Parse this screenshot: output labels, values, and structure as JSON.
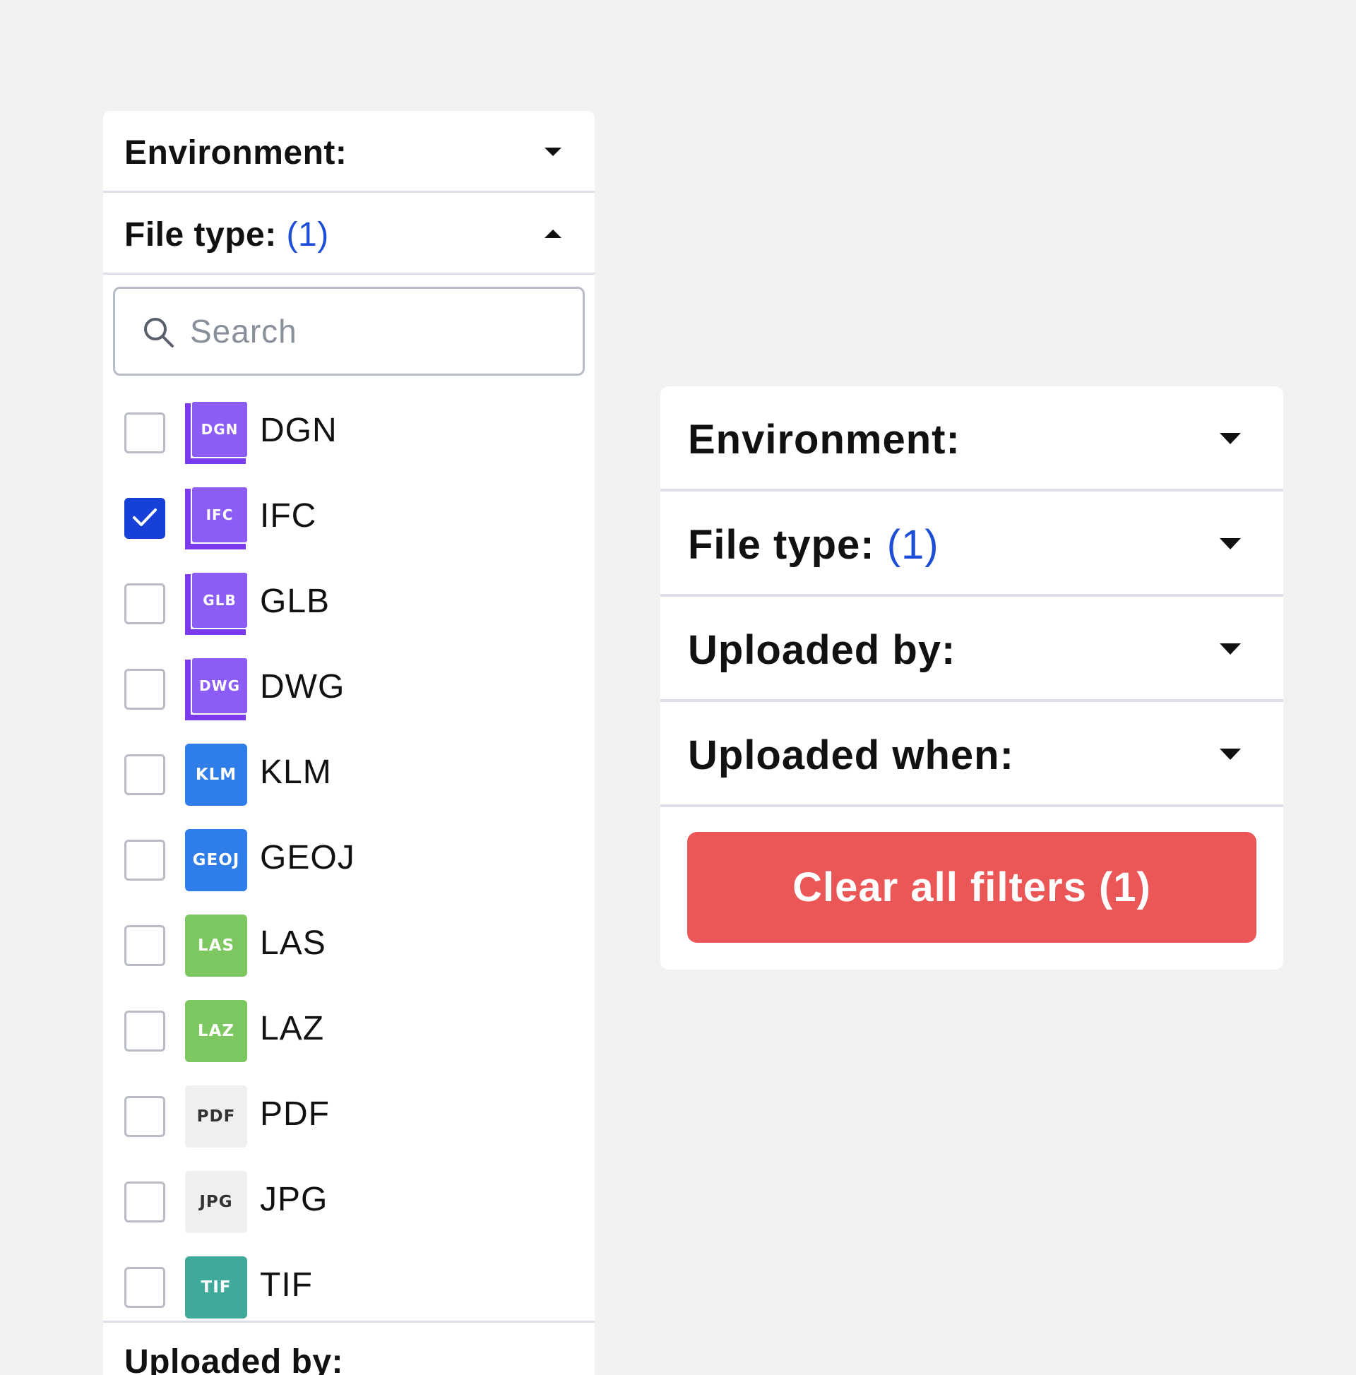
{
  "left_panel": {
    "environment": {
      "label": "Environment:",
      "icon": "chevron-down-icon"
    },
    "file_type": {
      "label": "File type:",
      "count": "(1)",
      "icon": "chevron-up-icon"
    },
    "search": {
      "placeholder": "Search",
      "value": "",
      "icon": "search-icon"
    },
    "files": [
      {
        "code": "DGN",
        "label": "DGN",
        "checked": false,
        "icon_style": "cube",
        "color": "#8b5cf6"
      },
      {
        "code": "IFC",
        "label": "IFC",
        "checked": true,
        "icon_style": "cube",
        "color": "#8b5cf6"
      },
      {
        "code": "GLB",
        "label": "GLB",
        "checked": false,
        "icon_style": "cube",
        "color": "#8b5cf6"
      },
      {
        "code": "DWG",
        "label": "DWG",
        "checked": false,
        "icon_style": "cube",
        "color": "#8b5cf6"
      },
      {
        "code": "KLM",
        "label": "KLM",
        "checked": false,
        "icon_style": "badge",
        "color": "#2f7de8"
      },
      {
        "code": "GEOJ",
        "label": "GEOJ",
        "checked": false,
        "icon_style": "badge",
        "color": "#2f7de8"
      },
      {
        "code": "LAS",
        "label": "LAS",
        "checked": false,
        "icon_style": "badge",
        "color": "#7cc75f"
      },
      {
        "code": "LAZ",
        "label": "LAZ",
        "checked": false,
        "icon_style": "badge",
        "color": "#7cc75f"
      },
      {
        "code": "PDF",
        "label": "PDF",
        "checked": false,
        "icon_style": "badge",
        "color": "#efefef"
      },
      {
        "code": "JPG",
        "label": "JPG",
        "checked": false,
        "icon_style": "badge",
        "color": "#efefef"
      },
      {
        "code": "TIF",
        "label": "TIF",
        "checked": false,
        "icon_style": "badge",
        "color": "#3fa99a"
      }
    ],
    "uploaded_by_partial": "Uploaded by:"
  },
  "right_panel": {
    "environment": {
      "label": "Environment:",
      "icon": "chevron-down-icon"
    },
    "file_type": {
      "label": "File type:",
      "count": "(1)",
      "icon": "chevron-down-icon"
    },
    "uploaded_by": {
      "label": "Uploaded by:",
      "icon": "chevron-down-icon"
    },
    "uploaded_when": {
      "label": "Uploaded when:",
      "icon": "chevron-down-icon"
    },
    "clear_button": {
      "label": "Clear all filters (1)"
    }
  },
  "colors": {
    "accent_blue": "#1d4ed8",
    "checkbox_checked": "#1640d8",
    "clear_button_red": "#eb5757",
    "divider": "#dcdee8",
    "background": "#f2f2f2"
  }
}
